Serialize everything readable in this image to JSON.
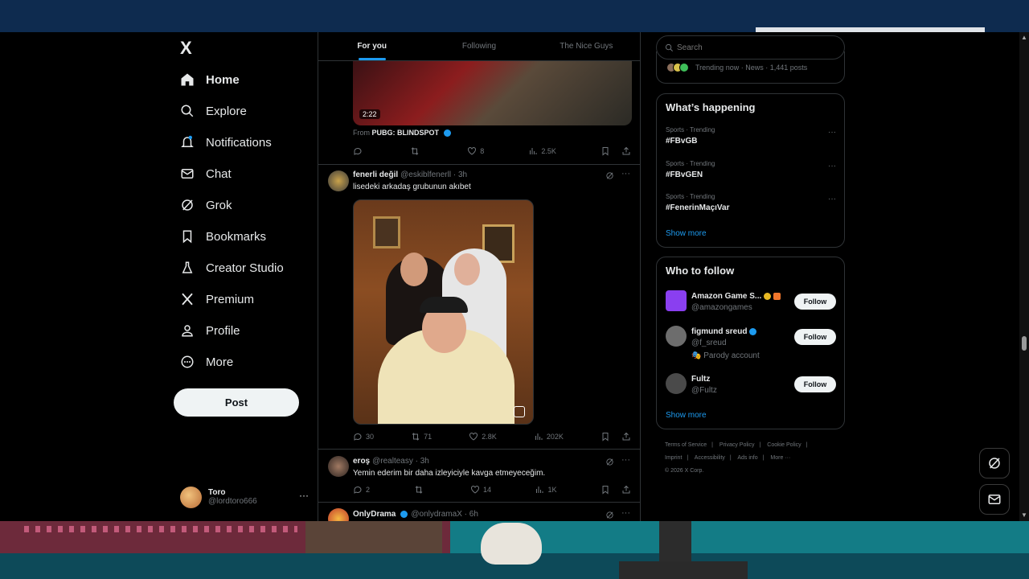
{
  "nav": {
    "logo": "X",
    "items": [
      {
        "label": "Home",
        "icon": "home-icon"
      },
      {
        "label": "Explore",
        "icon": "search-icon"
      },
      {
        "label": "Notifications",
        "icon": "bell-icon"
      },
      {
        "label": "Chat",
        "icon": "mail-icon"
      },
      {
        "label": "Grok",
        "icon": "grok-icon"
      },
      {
        "label": "Bookmarks",
        "icon": "bookmark-icon"
      },
      {
        "label": "Creator Studio",
        "icon": "flask-icon"
      },
      {
        "label": "Premium",
        "icon": "x-icon"
      },
      {
        "label": "Profile",
        "icon": "person-icon"
      },
      {
        "label": "More",
        "icon": "more-circle-icon"
      }
    ],
    "post_label": "Post",
    "account": {
      "name": "Toro",
      "handle": "@lordtoro666",
      "more": "···"
    }
  },
  "tabs": [
    {
      "label": "For you",
      "active": true
    },
    {
      "label": "Following",
      "active": false
    },
    {
      "label": "The Nice Guys",
      "active": false
    }
  ],
  "feed": {
    "video_post": {
      "duration": "2:22",
      "from_prefix": "From",
      "from_source": "PUBG: BLINDSPOT",
      "replies": "",
      "reposts": "",
      "likes": "8",
      "views": "2.5K"
    },
    "post1": {
      "name": "fenerli değil",
      "handle": "@eskiblfenerll · 3h",
      "text": "lisedeki arkadaş grubunun akıbet",
      "replies": "30",
      "reposts": "71",
      "likes": "2.8K",
      "views": "202K"
    },
    "post2": {
      "name": "eroş",
      "handle": "@realteasy · 3h",
      "text": "Yemin ederim bir daha izleyiciyle kavga etmeyeceğim.",
      "replies": "2",
      "reposts": "",
      "likes": "14",
      "views": "1K"
    },
    "post3": {
      "name": "OnlyDrama",
      "handle": "@onlydramaX · 6h"
    }
  },
  "right": {
    "search_placeholder": "Search",
    "trend_top": "Trending now · News · 1,441 posts",
    "happening_title": "What’s happening",
    "trends": [
      {
        "category": "Sports · Trending",
        "name": "#FBvGB"
      },
      {
        "category": "Sports · Trending",
        "name": "#FBvGEN"
      },
      {
        "category": "Sports · Trending",
        "name": "#FenerinMaçıVar"
      }
    ],
    "show_more": "Show more",
    "who_title": "Who to follow",
    "follows": [
      {
        "name": "Amazon Game S...",
        "handle": "@amazongames",
        "extra": "",
        "button": "Follow"
      },
      {
        "name": "figmund sreud",
        "handle": "@f_sreud",
        "extra": "🎭 Parody account",
        "button": "Follow"
      },
      {
        "name": "Fultz",
        "handle": "@Fultz",
        "extra": "",
        "button": "Follow"
      }
    ],
    "who_show_more": "Show more",
    "footer": [
      "Terms of Service",
      "|",
      "Privacy Policy",
      "|",
      "Cookie Policy",
      "|",
      "Imprint",
      "|",
      "Accessibility",
      "|",
      "Ads info",
      "|",
      "More ···",
      "© 2026 X Corp."
    ]
  }
}
